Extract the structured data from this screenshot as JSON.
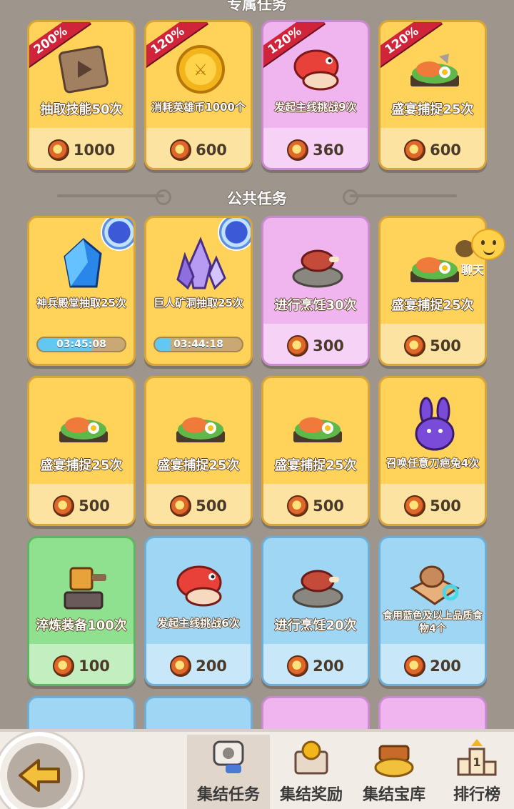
{
  "sections": {
    "exclusive_title": "专属任务",
    "public_title": "公共任务"
  },
  "exclusive_tasks": [
    {
      "badge": "200%",
      "label": "抽取技能50次",
      "reward": "1000",
      "color": "yellow",
      "icon": "skill-ticket-icon"
    },
    {
      "badge": "120%",
      "label": "消耗英雄币1000个",
      "reward": "600",
      "color": "yellow",
      "icon": "hero-coin-icon"
    },
    {
      "badge": "120%",
      "label": "发起主线挑战9次",
      "reward": "360",
      "color": "purple",
      "icon": "red-dino-icon"
    },
    {
      "badge": "120%",
      "label": "盛宴捕捉25次",
      "reward": "600",
      "color": "yellow",
      "icon": "feast-tray-icon"
    }
  ],
  "public_tasks": [
    {
      "label": "神兵殿堂抽取25次",
      "timer": "03:45:08",
      "progress": 0.62,
      "color": "yellow",
      "icon": "blue-crystal-icon"
    },
    {
      "label": "巨人矿洞抽取25次",
      "timer": "03:44:18",
      "progress": 0.18,
      "color": "yellow",
      "icon": "purple-crystal-icon"
    },
    {
      "label": "进行烹饪30次",
      "reward": "300",
      "color": "purple",
      "icon": "cooking-meat-icon"
    },
    {
      "label": "盛宴捕捉25次",
      "reward": "500",
      "color": "yellow",
      "icon": "feast-tray-icon"
    },
    {
      "label": "盛宴捕捉25次",
      "reward": "500",
      "color": "yellow",
      "icon": "feast-tray-icon"
    },
    {
      "label": "盛宴捕捉25次",
      "reward": "500",
      "color": "yellow",
      "icon": "feast-tray-icon"
    },
    {
      "label": "盛宴捕捉25次",
      "reward": "500",
      "color": "yellow",
      "icon": "feast-tray-icon"
    },
    {
      "label": "召唤任意刀疤兔4次",
      "reward": "500",
      "color": "yellow",
      "icon": "purple-rabbit-icon"
    },
    {
      "label": "淬炼装备100次",
      "reward": "100",
      "color": "green",
      "icon": "anvil-hammer-icon"
    },
    {
      "label": "发起主线挑战6次",
      "reward": "200",
      "color": "blue",
      "icon": "red-dino-icon"
    },
    {
      "label": "进行烹饪20次",
      "reward": "200",
      "color": "blue",
      "icon": "cooking-meat-icon"
    },
    {
      "label": "食用蓝色及以上品质食物4个",
      "reward": "200",
      "color": "blue",
      "icon": "food-plate-icon"
    }
  ],
  "chat": {
    "label": "聊天"
  },
  "bottom_nav": [
    {
      "label": "集结任务",
      "active": true,
      "icon": "scroll-task-icon"
    },
    {
      "label": "集结奖励",
      "active": false,
      "icon": "reward-chest-icon"
    },
    {
      "label": "集结宝库",
      "active": false,
      "icon": "treasure-gold-icon"
    },
    {
      "label": "排行榜",
      "active": false,
      "icon": "podium-icon"
    }
  ],
  "colors": {
    "card_yellow": "#ffd25a",
    "card_purple": "#f0b4ef",
    "card_green": "#8fe08f",
    "card_blue": "#9fd6f4",
    "badge_red": "#d0243a",
    "background": "#9e968d"
  }
}
